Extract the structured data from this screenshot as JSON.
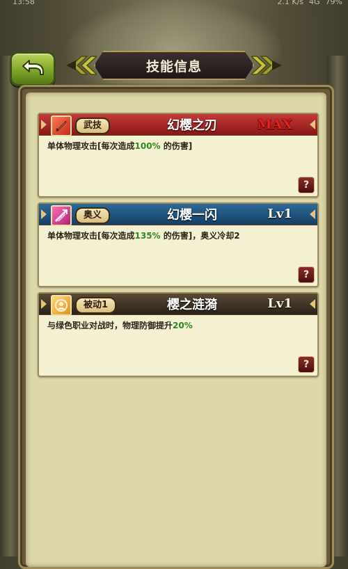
{
  "status_bar": {
    "time": "13:58",
    "speed": "2.1 K/s",
    "network": "4G",
    "battery": "79%"
  },
  "title": "技能信息",
  "skills": [
    {
      "type": "武技",
      "name": "幻樱之刃",
      "level": "MAX",
      "desc_prefix": "单体物理攻击[每次造成",
      "desc_pct": "100%",
      "desc_suffix": " 的伤害]",
      "help": "?",
      "icon": "sword-icon",
      "header_color": "#a32424"
    },
    {
      "type": "奥义",
      "name": "幻樱一闪",
      "level": "Lv1",
      "desc_prefix": "单体物理攻击[每次造成",
      "desc_pct": "135%",
      "desc_suffix": " 的伤害]，奥义冷却2",
      "help": "?",
      "icon": "slash-icon",
      "header_color": "#1f5380"
    },
    {
      "type": "被动1",
      "name": "樱之涟漪",
      "level": "Lv1",
      "desc_prefix": "与绿色职业对战时，物理防御提升",
      "desc_pct": "20%",
      "desc_suffix": "",
      "help": "?",
      "icon": "shield-person-icon",
      "header_color": "#3e3123"
    }
  ]
}
